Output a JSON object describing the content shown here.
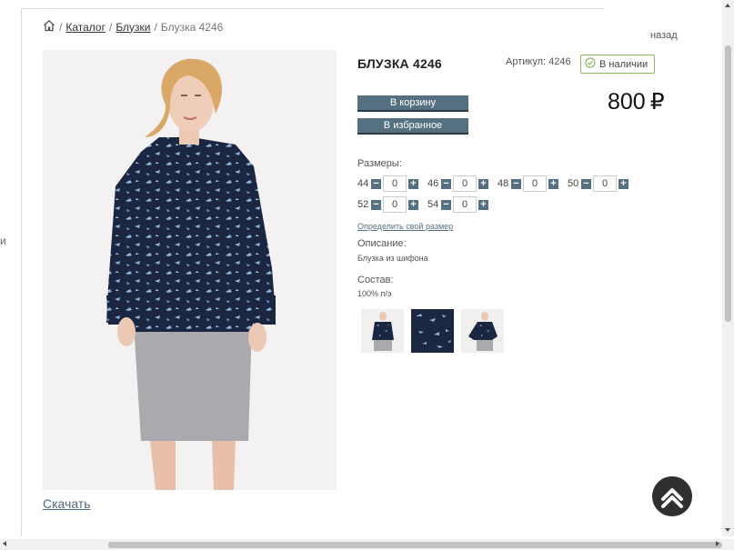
{
  "breadcrumb": {
    "items": [
      {
        "label": "Каталог"
      },
      {
        "label": "Блузки"
      }
    ],
    "current": "Блузка 4246",
    "separator": "/"
  },
  "nav": {
    "back_label": "назад",
    "edge_glyph": "и"
  },
  "product": {
    "title": "БЛУЗКА 4246",
    "sku_label": "Артикул: 4246",
    "stock_label": "В наличии",
    "price": "800",
    "currency": "₽",
    "add_to_cart_label": "В корзину",
    "add_to_favorites_label": "В избранное",
    "sizes_label": "Размеры:",
    "sizes_row1": [
      {
        "size": "44",
        "qty": "0"
      },
      {
        "size": "46",
        "qty": "0"
      },
      {
        "size": "48",
        "qty": "0"
      },
      {
        "size": "50",
        "qty": "0"
      }
    ],
    "sizes_row2": [
      {
        "size": "52",
        "qty": "0"
      },
      {
        "size": "54",
        "qty": "0"
      }
    ],
    "stepper_minus": "−",
    "stepper_plus": "+",
    "size_guide_link": "Определить свой размер",
    "description_label": "Описание:",
    "description_text": "Блузка из шифона",
    "composition_label": "Состав:",
    "composition_text": "100% п/э",
    "download_label": "Скачать"
  },
  "colors": {
    "accent": "#557181",
    "stock_border": "#8eb760",
    "blouse": "#1b2740",
    "print": "#8db3dc",
    "skirt": "#a9a9ae"
  },
  "icons": [
    "home-icon",
    "check-circle-icon",
    "chevron-up-icon"
  ]
}
